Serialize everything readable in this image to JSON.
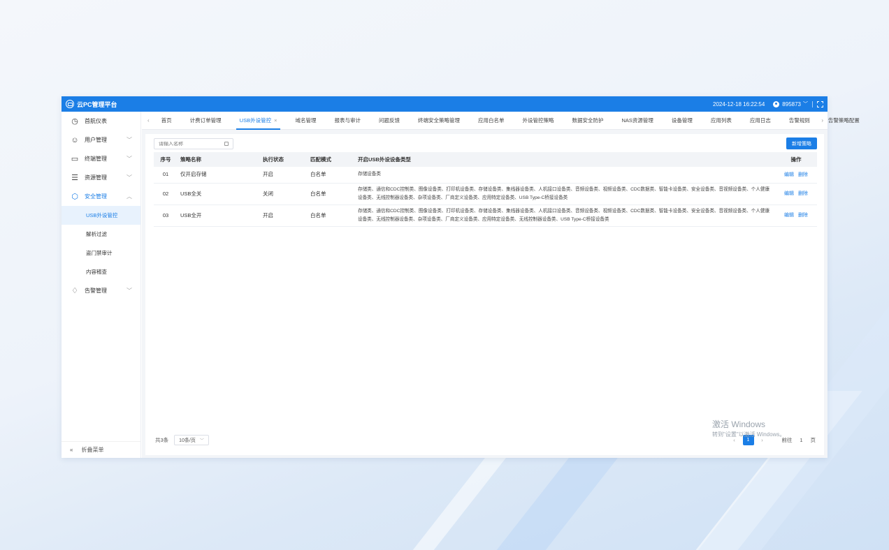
{
  "header": {
    "title": "云PC管理平台",
    "datetime": "2024-12-18 16:22:54",
    "user": "895873",
    "icons": {
      "logo": "cloud-pc-logo-icon",
      "user": "user-avatar-icon",
      "fullscreen": "fullscreen-icon"
    }
  },
  "sidebar": {
    "items": [
      {
        "label": "首航仪表",
        "icon": "dashboard-icon"
      },
      {
        "label": "用户管理",
        "icon": "user-icon"
      },
      {
        "label": "终端管理",
        "icon": "terminal-icon"
      },
      {
        "label": "资源管理",
        "icon": "resource-icon"
      },
      {
        "label": "安全管理",
        "icon": "security-icon"
      },
      {
        "label": "告警管理",
        "icon": "bell-icon"
      }
    ],
    "security_sub": [
      "USB外设管控",
      "解析过滤",
      "盗门禁审计",
      "内容稽查"
    ],
    "footer_label": "折叠菜单"
  },
  "tabs": [
    "首页",
    "计费订单管理",
    "USB外设管控",
    "域名管理",
    "报表与审计",
    "问题反馈",
    "终端安全策略管理",
    "应用白名单",
    "外设管控策略",
    "数据安全防护",
    "NAS资源管理",
    "设备管理",
    "应用列表",
    "应用日志",
    "告警规则",
    "告警策略配置"
  ],
  "toolbar": {
    "search_placeholder": "请输入名称",
    "add_label": "新增策略"
  },
  "table": {
    "headers": [
      "序号",
      "策略名称",
      "执行状态",
      "匹配模式",
      "开启USB外设设备类型",
      "操作"
    ],
    "rows": [
      {
        "idx": "01",
        "name": "仅开启存储",
        "status": "开启",
        "mode": "白名单",
        "types": "存储设备类"
      },
      {
        "idx": "02",
        "name": "USB全关",
        "status": "关闭",
        "mode": "白名单",
        "types": "存储类、通信和CDC控制类、图像设备类、打印机设备类、存储设备类、集线器设备类、人机接口设备类、音频设备类、视频设备类、CDC数据类、智能卡设备类、安全设备类、音视频设备类、个人健康设备类、无线控制器设备类、杂项设备类、厂商定义设备类、应用特定设备类、USB Type-C桥接设备类"
      },
      {
        "idx": "03",
        "name": "USB全开",
        "status": "开启",
        "mode": "白名单",
        "types": "存储类、通信和CDC控制类、图像设备类、打印机设备类、存储设备类、集线器设备类、人机接口设备类、音频设备类、视频设备类、CDC数据类、智能卡设备类、安全设备类、音视频设备类、个人健康设备类、无线控制器设备类、杂项设备类、厂商定义设备类、应用特定设备类、无线控制器设备类、USB Type-C桥接设备类"
      }
    ],
    "op_edit": "编辑",
    "op_delete": "删除"
  },
  "pager": {
    "total": "共3条",
    "page_size": "10条/页",
    "current": "1",
    "goto_label": "前往",
    "goto_value": "1",
    "goto_suffix": "页"
  },
  "watermark": {
    "line1": "激活 Windows",
    "line2": "转到\"设置\"以激活 Windows。"
  },
  "colors": {
    "primary": "#1b7ee6",
    "header_bg": "#f2f4f7"
  }
}
